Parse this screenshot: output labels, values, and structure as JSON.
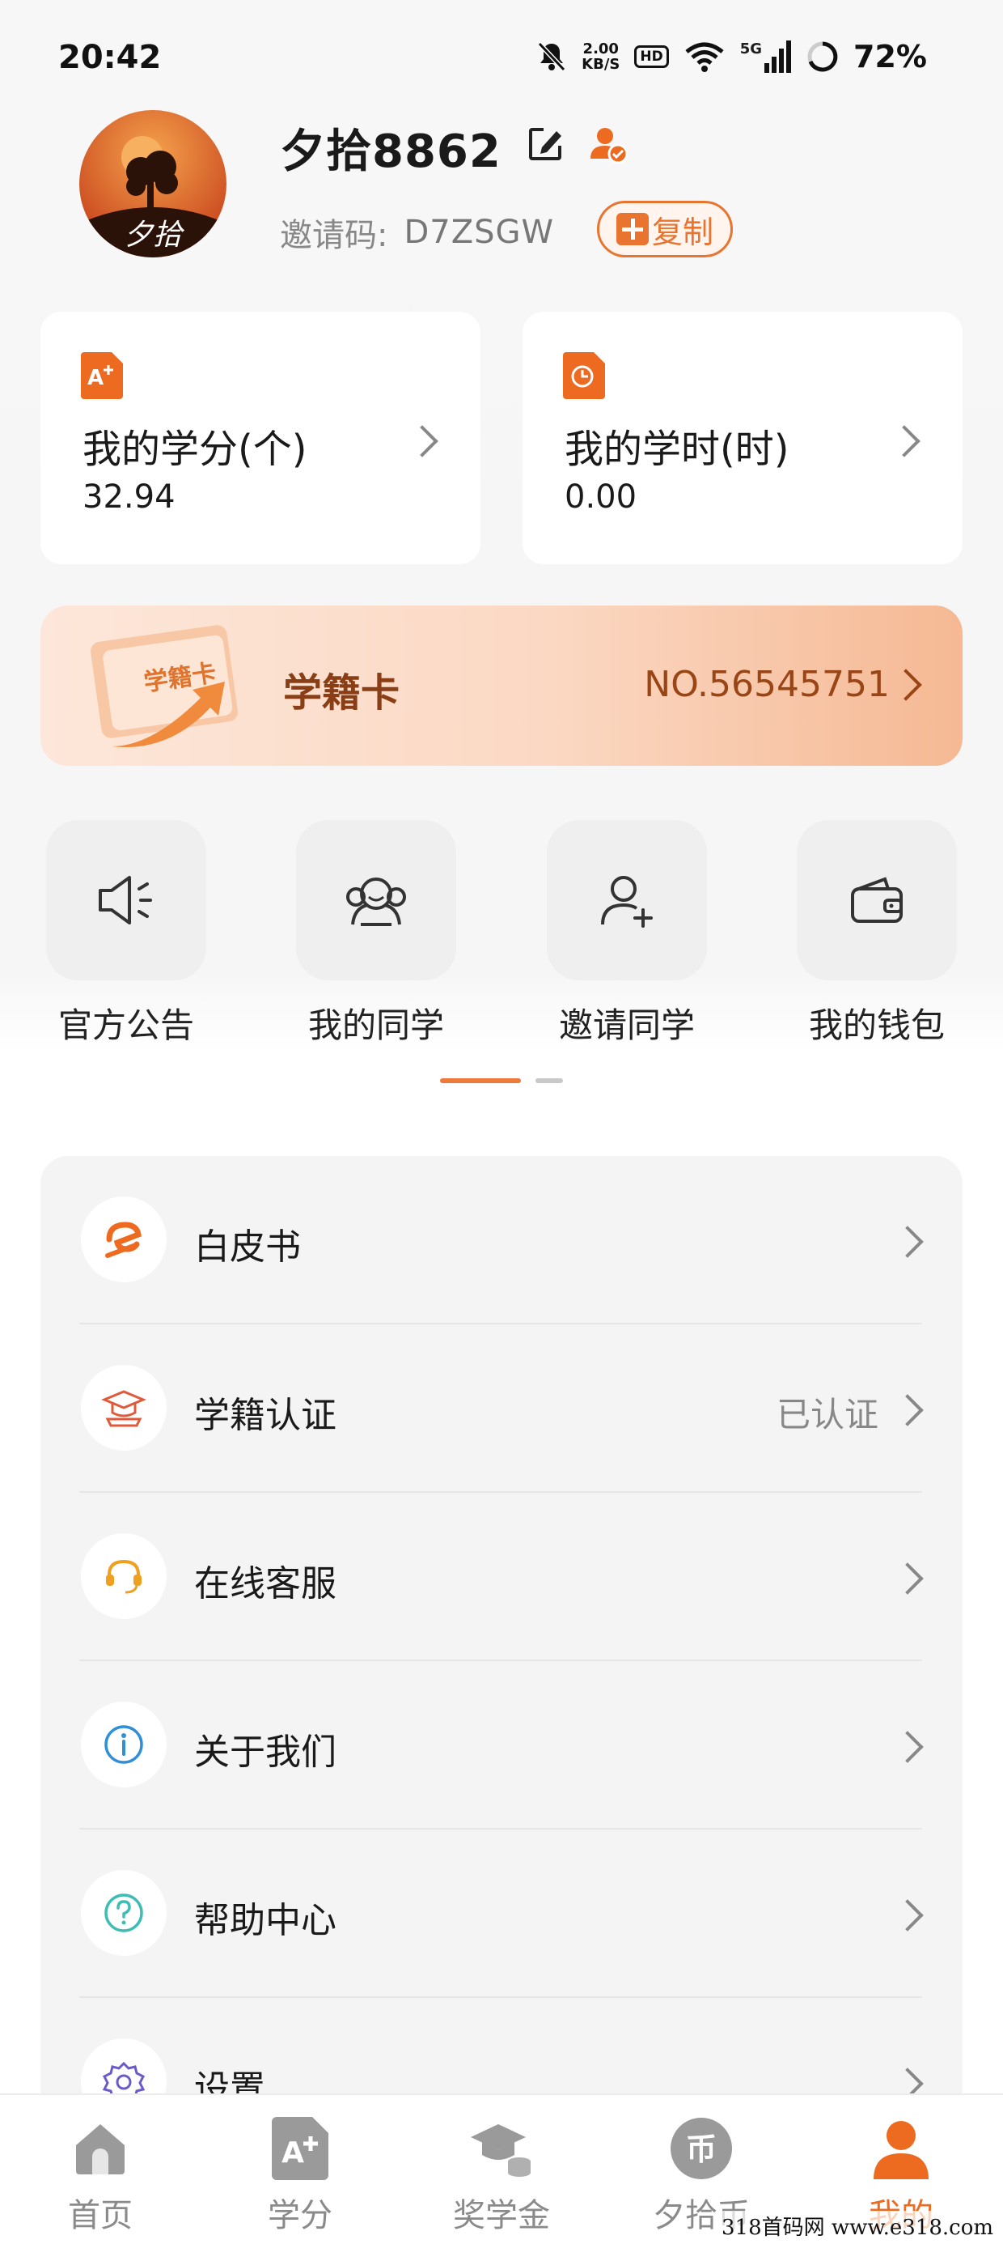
{
  "status_bar": {
    "time": "20:42",
    "net_speed_value": "2.00",
    "net_speed_unit": "KB/S",
    "hd_label": "HD",
    "network_label": "5G",
    "battery": "72%",
    "icons": [
      "mute-icon",
      "wifi-icon",
      "signal-icon",
      "battery-icon"
    ]
  },
  "profile": {
    "username": "夕拾8862",
    "avatar_text": "夕拾",
    "invite_label": "邀请码:",
    "invite_code": "D7ZSGW",
    "copy_label": "复制"
  },
  "stats": [
    {
      "label": "我的学分(个)",
      "value": "32.94",
      "icon": "credit-icon"
    },
    {
      "label": "我的学时(时)",
      "value": "0.00",
      "icon": "clock-icon"
    }
  ],
  "student_card": {
    "title": "学籍卡",
    "number": "NO.56545751",
    "image_text": "学籍卡"
  },
  "quick_actions": [
    {
      "label": "官方公告",
      "icon": "megaphone-icon"
    },
    {
      "label": "我的同学",
      "icon": "classmates-icon"
    },
    {
      "label": "邀请同学",
      "icon": "add-user-icon"
    },
    {
      "label": "我的钱包",
      "icon": "wallet-icon"
    }
  ],
  "pager": {
    "total": 2,
    "active": 1
  },
  "menu": [
    {
      "label": "白皮书",
      "value": "",
      "icon": "whitepaper-icon"
    },
    {
      "label": "学籍认证",
      "value": "已认证",
      "icon": "graduation-cap-icon"
    },
    {
      "label": "在线客服",
      "value": "",
      "icon": "headset-icon"
    },
    {
      "label": "关于我们",
      "value": "",
      "icon": "info-icon"
    },
    {
      "label": "帮助中心",
      "value": "",
      "icon": "help-icon"
    },
    {
      "label": "设置",
      "value": "",
      "icon": "settings-icon"
    }
  ],
  "tabbar": [
    {
      "label": "首页",
      "icon": "home-icon",
      "active": false
    },
    {
      "label": "学分",
      "icon": "credit-tab-icon",
      "active": false
    },
    {
      "label": "奖学金",
      "icon": "scholarship-icon",
      "active": false
    },
    {
      "label": "夕拾币",
      "icon": "coin-icon",
      "active": false
    },
    {
      "label": "我的",
      "icon": "profile-icon",
      "active": true
    }
  ],
  "colors": {
    "accent": "#ec6b21",
    "banner_text": "#8a3e16",
    "muted": "#8a8a8a"
  },
  "watermark": "318首码网 www.e318.com"
}
